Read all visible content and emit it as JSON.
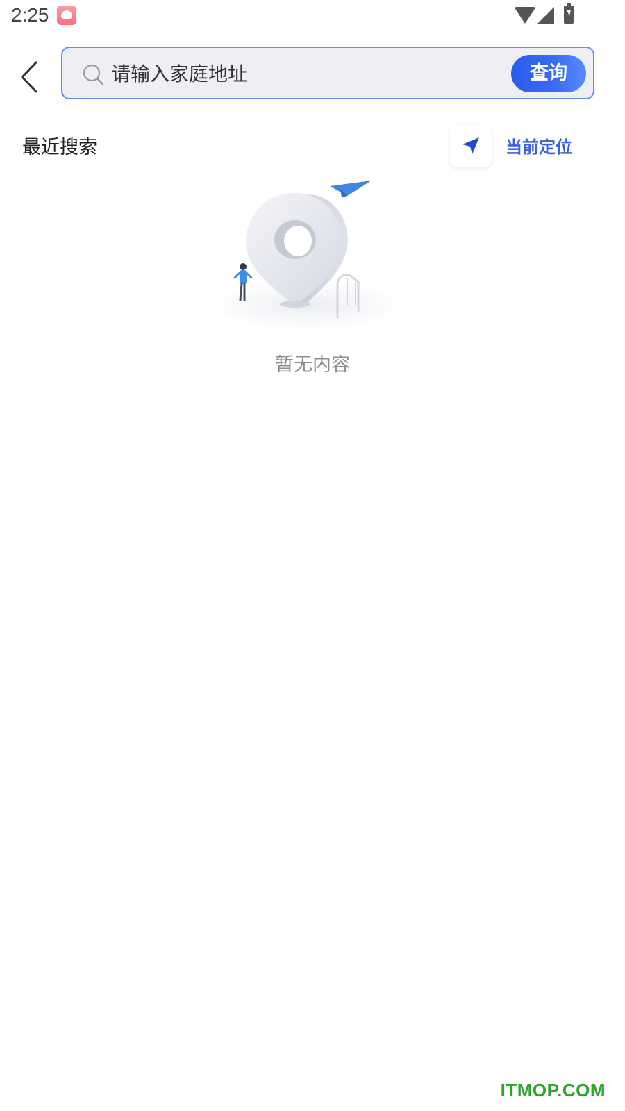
{
  "status_bar": {
    "time": "2:25"
  },
  "header": {
    "search": {
      "placeholder": "请输入家庭地址",
      "value": ""
    },
    "query_button_label": "查询"
  },
  "recent": {
    "title": "最近搜索",
    "current_location_label": "当前定位"
  },
  "empty_state": {
    "text": "暂无内容"
  },
  "watermark": "ITMOP.COM",
  "colors": {
    "accent": "#3a5fe0",
    "search_border": "#5b93e8",
    "search_bg": "#eeeff2",
    "empty_text": "#8d8d8d",
    "watermark": "#2aa52a"
  }
}
